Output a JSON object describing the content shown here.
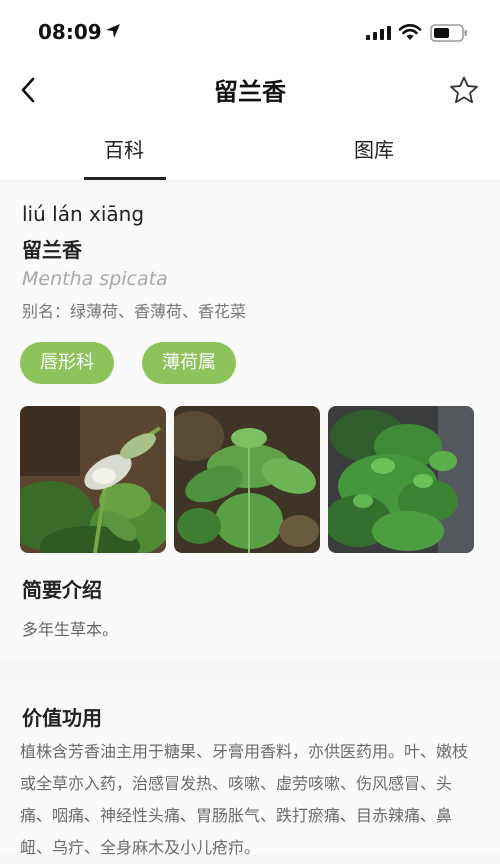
{
  "status": {
    "time": "08:09"
  },
  "nav": {
    "title": "留兰香"
  },
  "tabs": [
    {
      "label": "百科"
    },
    {
      "label": "图库"
    }
  ],
  "plant": {
    "pinyin": "liú lán xiāng",
    "name": "留兰香",
    "latin": "Mentha spicata",
    "alias": "别名：绿薄荷、香薄荷、香花菜",
    "tags": [
      "唇形科",
      "薄荷属"
    ]
  },
  "intro": {
    "heading": "简要介绍",
    "text": "多年生草本。"
  },
  "value": {
    "heading": "价值功用",
    "text": "植株含芳香油主用于糖果、牙膏用香料，亦供医药用。叶、嫩枝或全草亦入药，治感冒发热、咳嗽、虚劳咳嗽、伤风感冒、头痛、咽痛、神经性头痛、胃肠胀气、跌打瘀痛、目赤辣痛、鼻衄、乌疔、全身麻木及小儿疮疖。"
  },
  "colors": {
    "accent": "#8dc35a",
    "tab_underline": "#222222"
  }
}
